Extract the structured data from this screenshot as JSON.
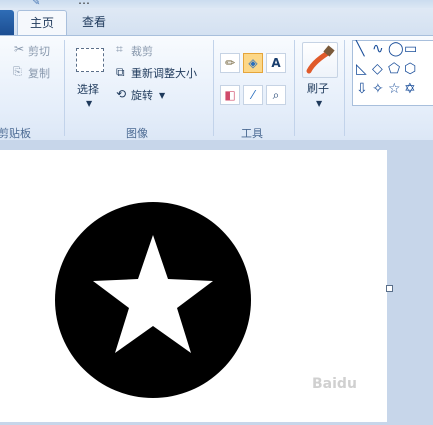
{
  "window": {
    "title": "…"
  },
  "tabs": {
    "home": "主页",
    "view": "查看"
  },
  "clipboard": {
    "cut": "剪切",
    "paste_copy": "复制",
    "group_label": "剪贴板"
  },
  "image": {
    "select": "选择",
    "crop": "裁剪",
    "resize": "重新调整大小",
    "rotate": "旋转",
    "group_label": "图像"
  },
  "tools": {
    "group_label": "工具"
  },
  "brushes": {
    "label": "刷子"
  },
  "canvas": {
    "watermark": "Baidu"
  },
  "colors": {
    "ribbon_bg": "#e5eefa",
    "accent": "#1c4e92",
    "canvas": "#ffffff",
    "shape_fill": "#000000"
  }
}
